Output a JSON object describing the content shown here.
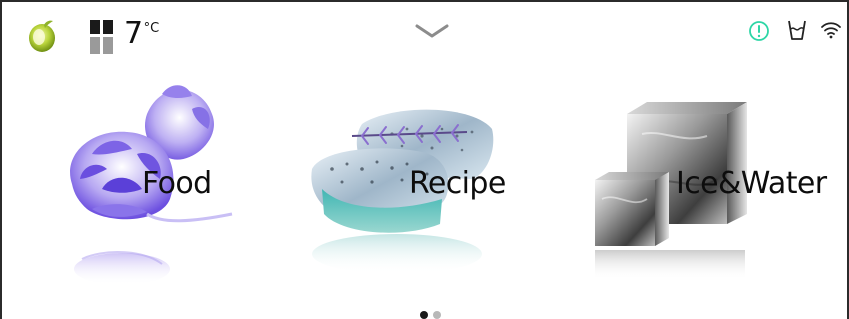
{
  "status": {
    "temperature": {
      "value": "7",
      "unit": "°C"
    },
    "icons": [
      "eco-mode-icon",
      "fridge-compartment-icon",
      "chevron-down-icon",
      "alert-icon",
      "water-cup-icon",
      "wifi-icon"
    ]
  },
  "tiles": [
    {
      "label": "Food",
      "image": "artichoke"
    },
    {
      "label": "Recipe",
      "image": "fish-with-rosemary"
    },
    {
      "label": "Ice&Water",
      "image": "ice-cubes"
    }
  ],
  "pagination": {
    "current_page": 1,
    "total_pages": 2
  },
  "colors": {
    "alert": "#2ed6a6",
    "text": "#111111",
    "dot_active": "#1a1a1a",
    "dot_inactive": "#b8b8b8"
  }
}
